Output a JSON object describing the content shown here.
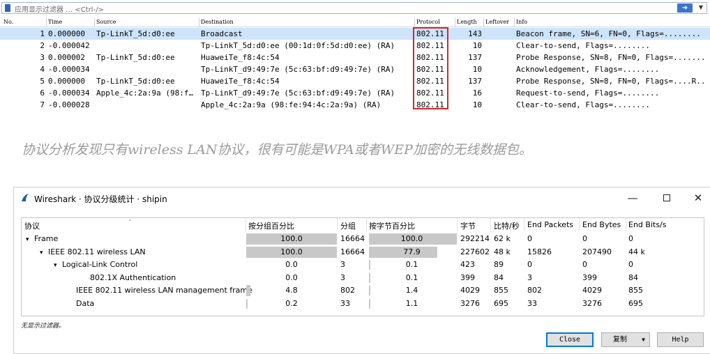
{
  "packet_list": {
    "filter": {
      "placeholder": "应用显示过滤器 … <Ctrl-/>",
      "apply_icon": "arrow-right-icon",
      "dropdown_icon": "chevron-down-icon"
    },
    "columns": [
      "No.",
      "Time",
      "Source",
      "Destination",
      "Protocol",
      "Length",
      "Leftover",
      "Info"
    ],
    "rows": [
      {
        "no": "1",
        "time": "0.000000",
        "source": "Tp-LinkT_5d:d0:ee",
        "destination": "Broadcast",
        "protocol": "802.11",
        "length": "143",
        "info": "Beacon frame, SN=6, FN=0, Flags=........"
      },
      {
        "no": "2",
        "time": "-0.000042",
        "source": "",
        "destination": "Tp-LinkT_5d:d0:ee (00:1d:0f:5d:d0:ee) (RA)",
        "protocol": "802.11",
        "length": "10",
        "info": "Clear-to-send, Flags=........"
      },
      {
        "no": "3",
        "time": "0.000002",
        "source": "Tp-LinkT_5d:d0:ee",
        "destination": "HuaweiTe_f8:4c:54",
        "protocol": "802.11",
        "length": "137",
        "info": "Probe Response, SN=8, FN=0, Flags=......."
      },
      {
        "no": "4",
        "time": "-0.000034",
        "source": "",
        "destination": "Tp-LinkT_d9:49:7e (5c:63:bf:d9:49:7e) (RA)",
        "protocol": "802.11",
        "length": "10",
        "info": "Acknowledgement, Flags=........"
      },
      {
        "no": "5",
        "time": "0.000000",
        "source": "Tp-LinkT_5d:d0:ee",
        "destination": "HuaweiTe_f8:4c:54",
        "protocol": "802.11",
        "length": "137",
        "info": "Probe Response, SN=8, FN=0, Flags=....R.."
      },
      {
        "no": "6",
        "time": "-0.000034",
        "source": "Apple_4c:2a:9a (98:f…",
        "destination": "Tp-LinkT_d9:49:7e (5c:63:bf:d9:49:7e) (RA)",
        "protocol": "802.11",
        "length": "16",
        "info": "Request-to-send, Flags=........"
      },
      {
        "no": "7",
        "time": "-0.000028",
        "source": "",
        "destination": "Apple_4c:2a:9a (98:fe:94:4c:2a:9a) (RA)",
        "protocol": "802.11",
        "length": "10",
        "info": "Clear-to-send, Flags=........"
      }
    ],
    "highlight_color": "#d22630",
    "selected_color": "#cde4fb"
  },
  "caption": "协议分析发现只有wireless LAN协议，很有可能是WPA或者WEP加密的无线数据包。",
  "dialog": {
    "title": "Wireshark · 协议分级统计 · shipin",
    "app_icon": "wireshark-fin-icon",
    "window_buttons": {
      "minimize": "—",
      "maximize_icon": "maximize-icon",
      "close": "✕"
    },
    "columns": [
      "协议",
      "按分组百分比",
      "分组",
      "按字节百分比",
      "字节",
      "比特/秒",
      "End Packets",
      "End Bytes",
      "End Bits/s"
    ],
    "rows": [
      {
        "protocol": "Frame",
        "twisty": "▾",
        "pct_packets": 100.0,
        "pct_packets_label": "100.0",
        "packets": "16664",
        "pct_bytes": 100.0,
        "pct_bytes_label": "100.0",
        "bytes": "292214",
        "bits_s": "62 k",
        "end_packets": "0",
        "end_bytes": "0",
        "end_bits_s": "0"
      },
      {
        "protocol": "IEEE 802.11 wireless LAN",
        "twisty": "▾",
        "pct_packets": 100.0,
        "pct_packets_label": "100.0",
        "packets": "16664",
        "pct_bytes": 77.9,
        "pct_bytes_label": "77.9",
        "bytes": "227602",
        "bits_s": "48 k",
        "end_packets": "15826",
        "end_bytes": "207490",
        "end_bits_s": "44 k"
      },
      {
        "protocol": "Logical-Link Control",
        "twisty": "▾",
        "pct_packets": 0.0,
        "pct_packets_label": "0.0",
        "packets": "3",
        "pct_bytes": 0.1,
        "pct_bytes_label": "0.1",
        "bytes": "423",
        "bits_s": "89",
        "end_packets": "0",
        "end_bytes": "0",
        "end_bits_s": "0"
      },
      {
        "protocol": "802.1X Authentication",
        "twisty": "",
        "pct_packets": 0.0,
        "pct_packets_label": "0.0",
        "packets": "3",
        "pct_bytes": 0.1,
        "pct_bytes_label": "0.1",
        "bytes": "399",
        "bits_s": "84",
        "end_packets": "3",
        "end_bytes": "399",
        "end_bits_s": "84"
      },
      {
        "protocol": "IEEE 802.11 wireless LAN management frame",
        "twisty": "",
        "pct_packets": 4.8,
        "pct_packets_label": "4.8",
        "packets": "802",
        "pct_bytes": 1.4,
        "pct_bytes_label": "1.4",
        "bytes": "4029",
        "bits_s": "855",
        "end_packets": "802",
        "end_bytes": "4029",
        "end_bits_s": "855"
      },
      {
        "protocol": "Data",
        "twisty": "",
        "pct_packets": 0.2,
        "pct_packets_label": "0.2",
        "packets": "33",
        "pct_bytes": 1.1,
        "pct_bytes_label": "1.1",
        "bytes": "3276",
        "bits_s": "695",
        "end_packets": "33",
        "end_bytes": "3276",
        "end_bits_s": "695"
      }
    ],
    "bar_color": "#c8c8c8",
    "status": "无显示过滤器。",
    "buttons": {
      "close": "Close",
      "copy": "复制",
      "copy_caret": "▼",
      "help": "Help"
    }
  }
}
